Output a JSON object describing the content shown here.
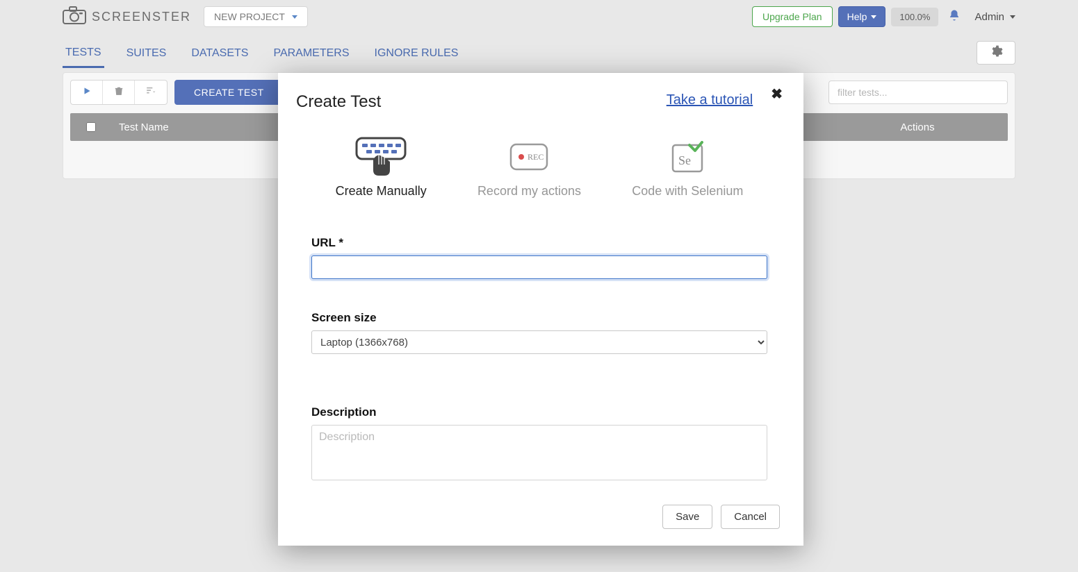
{
  "header": {
    "brand": "SCREENSTER",
    "project_dropdown": "NEW PROJECT",
    "upgrade": "Upgrade Plan",
    "help": "Help",
    "percent": "100.0%",
    "admin": "Admin"
  },
  "nav": {
    "tabs": [
      "TESTS",
      "SUITES",
      "DATASETS",
      "PARAMETERS",
      "IGNORE RULES"
    ]
  },
  "toolbar": {
    "create": "CREATE TEST",
    "filter_placeholder": "filter tests..."
  },
  "table": {
    "col_name": "Test Name",
    "col_actions": "Actions"
  },
  "modal": {
    "title": "Create Test",
    "tutorial": "Take a tutorial",
    "options": {
      "manual": "Create Manually",
      "record": "Record my actions",
      "selenium": "Code with Selenium",
      "rec_tag": "REC"
    },
    "url_label": "URL *",
    "screen_label": "Screen size",
    "screen_value": "Laptop (1366x768)",
    "desc_label": "Description",
    "desc_placeholder": "Description",
    "save": "Save",
    "cancel": "Cancel"
  }
}
